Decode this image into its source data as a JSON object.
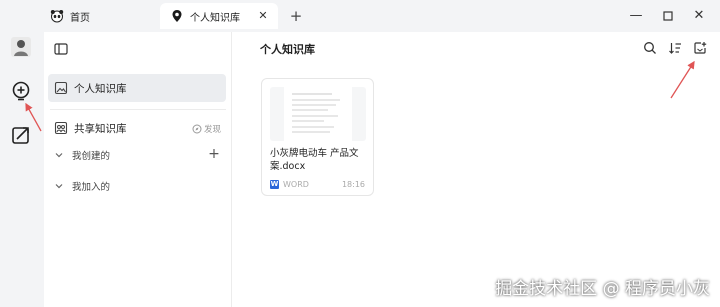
{
  "tabs": [
    {
      "label": "首页",
      "icon": "panda-icon",
      "active": false
    },
    {
      "label": "个人知识库",
      "icon": "location-pin-icon",
      "active": true
    }
  ],
  "window_controls": [
    "minimize-icon",
    "maximize-icon",
    "close-icon"
  ],
  "rail": {
    "items": [
      "avatar",
      "add-knowledge-icon",
      "share-export-icon"
    ]
  },
  "sidebar": {
    "items": {
      "personal": "个人知识库",
      "shared": "共享知识库",
      "discover": "发现"
    },
    "groups": {
      "created": "我创建的",
      "joined": "我加入的"
    }
  },
  "main": {
    "title": "个人知识库",
    "toolbar": [
      "search-icon",
      "sort-icon",
      "upload-icon"
    ],
    "documents": [
      {
        "name": "小灰牌电动车 产品文案.docx",
        "type": "WORD",
        "time": "18:16"
      }
    ]
  },
  "colors": {
    "accent": "#2b66d9",
    "arrow": "#e05555",
    "selected_bg": "#ebedf0"
  },
  "watermark": "掘金技术社区 @ 程序员小灰"
}
